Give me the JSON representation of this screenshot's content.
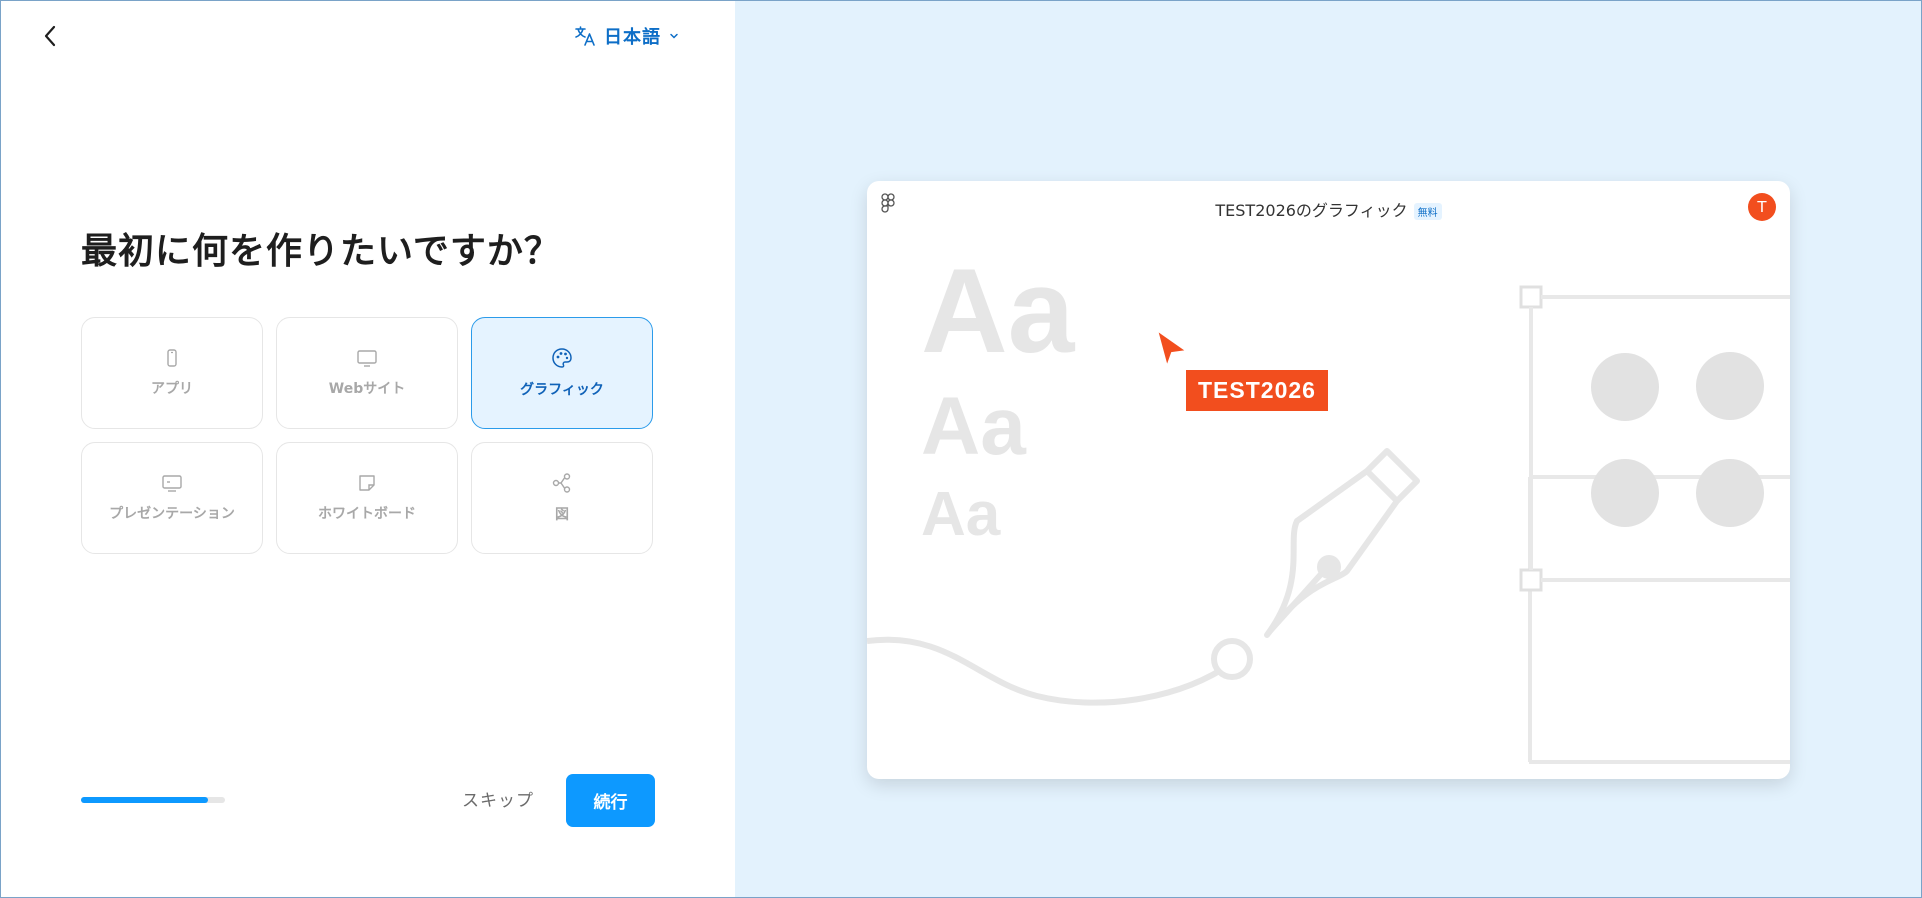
{
  "header": {
    "language_label": "日本語"
  },
  "main": {
    "title": "最初に何を作りたいですか？",
    "options": [
      {
        "label": "アプリ",
        "icon": "phone-icon",
        "selected": false
      },
      {
        "label": "Webサイト",
        "icon": "monitor-icon",
        "selected": false
      },
      {
        "label": "グラフィック",
        "icon": "palette-icon",
        "selected": true
      },
      {
        "label": "プレゼンテーション",
        "icon": "presentation-icon",
        "selected": false
      },
      {
        "label": "ホワイトボード",
        "icon": "sticky-note-icon",
        "selected": false
      },
      {
        "label": "図",
        "icon": "diagram-icon",
        "selected": false
      }
    ]
  },
  "footer": {
    "progress": 0.88,
    "skip_label": "スキップ",
    "continue_label": "続行"
  },
  "preview": {
    "title": "TEST2026のグラフィック",
    "badge": "無料",
    "avatar_initial": "T",
    "sample_text_large": "Aa",
    "sample_text_medium": "Aa",
    "sample_text_small": "Aa",
    "cursor_tag": "TEST2026"
  },
  "colors": {
    "accent": "#0d99ff",
    "selected_bg": "#e5f3ff",
    "right_bg": "#e3f2fd",
    "brand_orange": "#f24e1e"
  }
}
